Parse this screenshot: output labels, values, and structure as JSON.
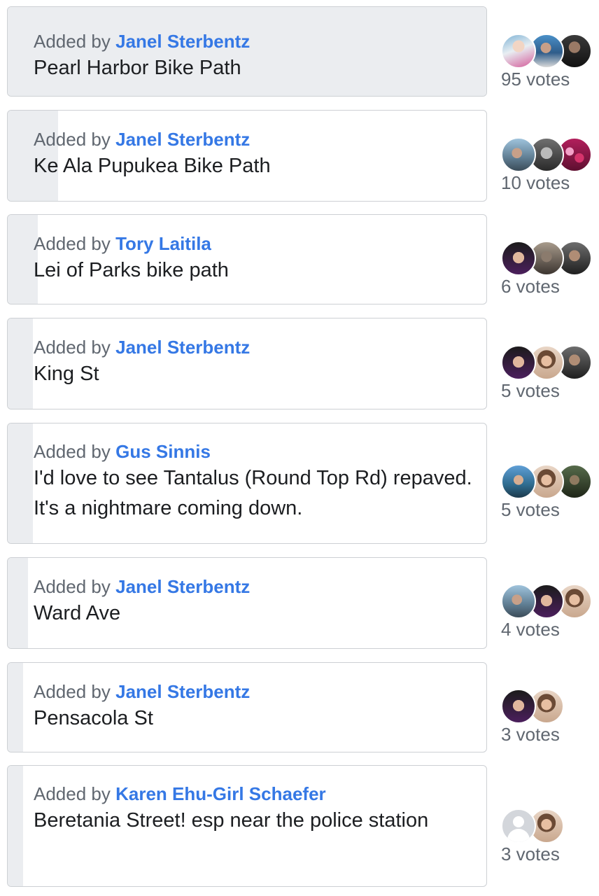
{
  "added_prefix": "Added by",
  "options": [
    {
      "author": "Janel Sterbentz",
      "title": "Pearl Harbor Bike Path",
      "votes": "95 votes",
      "progress": 1.0
    },
    {
      "author": "Janel Sterbentz",
      "title": "Ke Ala Pupukea Bike Path",
      "votes": "10 votes",
      "progress": 0.105
    },
    {
      "author": "Tory Laitila",
      "title": "Lei of Parks bike path",
      "votes": "6 votes",
      "progress": 0.063
    },
    {
      "author": "Janel Sterbentz",
      "title": "King St",
      "votes": "5 votes",
      "progress": 0.053
    },
    {
      "author": "Gus Sinnis",
      "title": "I'd love to see Tantalus (Round Top Rd) repaved. It's a nightmare coming down.",
      "votes": "5 votes",
      "progress": 0.053
    },
    {
      "author": "Janel Sterbentz",
      "title": "Ward Ave",
      "votes": "4 votes",
      "progress": 0.042
    },
    {
      "author": "Janel Sterbentz",
      "title": "Pensacola St",
      "votes": "3 votes",
      "progress": 0.032
    },
    {
      "author": "Karen Ehu-Girl Schaefer",
      "title": "Beretania Street! esp near the police station",
      "votes": "3 votes",
      "progress": 0.032
    }
  ],
  "colors": {
    "author_link": "#3578e5",
    "fill": "#ebedf0",
    "border": "#cdd0d4"
  },
  "voter_avatars": [
    "profile-photo",
    "profile-photo",
    "profile-photo",
    "default-profile-icon"
  ]
}
